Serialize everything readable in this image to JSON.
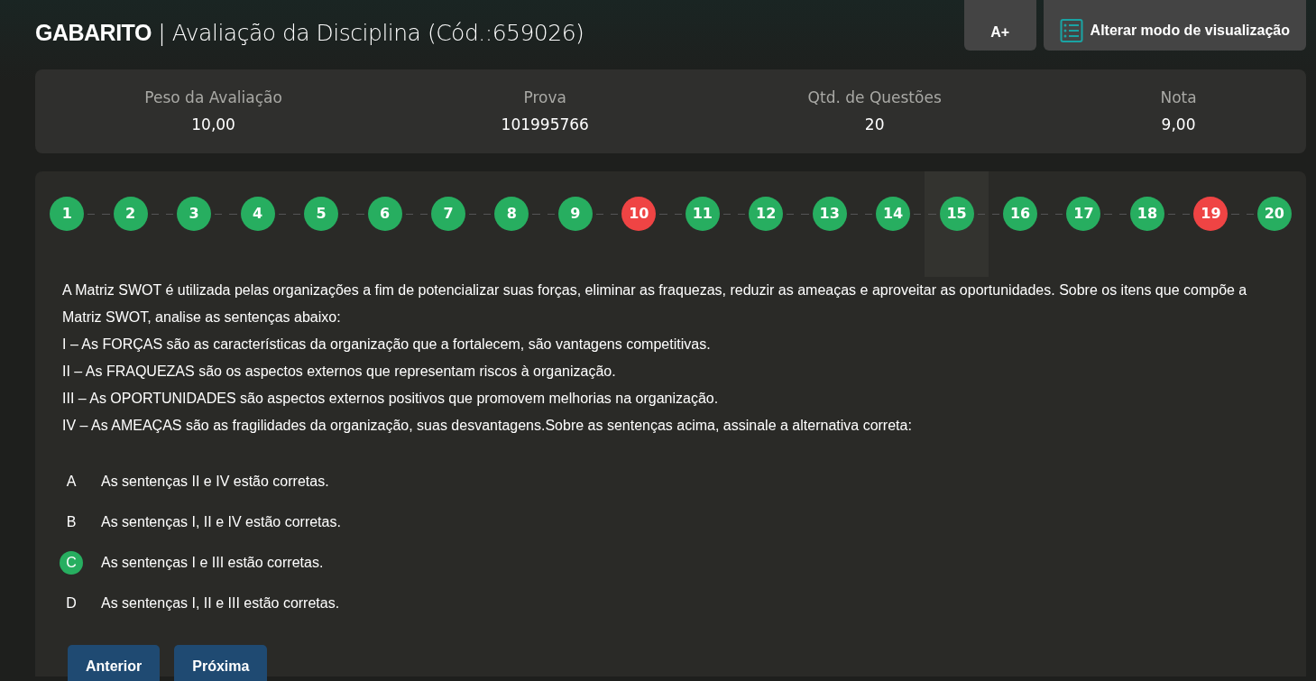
{
  "header": {
    "title_bold": "GABARITO",
    "separator": "|",
    "title": "Avaliação da Disciplina (Cód.:659026)",
    "buttons": [
      {
        "kind": "text",
        "label": "A+"
      },
      {
        "kind": "view",
        "label": "Alterar modo de visualização"
      }
    ]
  },
  "summary": [
    {
      "label": "Peso da Avaliação",
      "value": "10,00"
    },
    {
      "label": "Prova",
      "value": "101995766"
    },
    {
      "label": "Qtd. de Questões",
      "value": "20"
    },
    {
      "label": "Nota",
      "value": "9,00"
    }
  ],
  "questions": [
    {
      "number": "1",
      "correct": true,
      "selected": false
    },
    {
      "number": "2",
      "correct": true,
      "selected": false
    },
    {
      "number": "3",
      "correct": true,
      "selected": false
    },
    {
      "number": "4",
      "correct": true,
      "selected": false
    },
    {
      "number": "5",
      "correct": true,
      "selected": false
    },
    {
      "number": "6",
      "correct": true,
      "selected": false
    },
    {
      "number": "7",
      "correct": true,
      "selected": false
    },
    {
      "number": "8",
      "correct": true,
      "selected": false
    },
    {
      "number": "9",
      "correct": true,
      "selected": false
    },
    {
      "number": "10",
      "correct": false,
      "selected": false
    },
    {
      "number": "11",
      "correct": true,
      "selected": false
    },
    {
      "number": "12",
      "correct": true,
      "selected": false
    },
    {
      "number": "13",
      "correct": true,
      "selected": false
    },
    {
      "number": "14",
      "correct": true,
      "selected": false
    },
    {
      "number": "15",
      "correct": true,
      "selected": true
    },
    {
      "number": "16",
      "correct": true,
      "selected": false
    },
    {
      "number": "17",
      "correct": true,
      "selected": false
    },
    {
      "number": "18",
      "correct": true,
      "selected": false
    },
    {
      "number": "19",
      "correct": false,
      "selected": false
    },
    {
      "number": "20",
      "correct": true,
      "selected": false
    }
  ],
  "statement": [
    "A Matriz SWOT é utilizada pelas organizações a fim de potencializar suas forças, eliminar as fraquezas, reduzir as ameaças e aproveitar as oportunidades. Sobre os itens que compõe a Matriz SWOT, analise as sentenças abaixo:",
    "I – As FORÇAS são as características da organização que a fortalecem, são vantagens competitivas.",
    "II – As FRAQUEZAS são os aspectos externos que representam riscos à organização.",
    "III – As OPORTUNIDADES são aspectos externos positivos que promovem melhorias na organização.",
    "IV – As AMEAÇAS são as fragilidades da organização, suas desvantagens.Sobre as sentenças acima, assinale a alternativa correta:"
  ],
  "options": [
    {
      "letter": "A",
      "text": "As sentenças II e IV estão corretas.",
      "correct": false
    },
    {
      "letter": "B",
      "text": "As sentenças I, II e IV estão corretas.",
      "correct": false
    },
    {
      "letter": "C",
      "text": "As sentenças I e III estão corretas.",
      "correct": true
    },
    {
      "letter": "D",
      "text": "As sentenças I, II e III estão corretas.",
      "correct": false
    }
  ],
  "nav_buttons": [
    "Anterior",
    "Próxima"
  ]
}
